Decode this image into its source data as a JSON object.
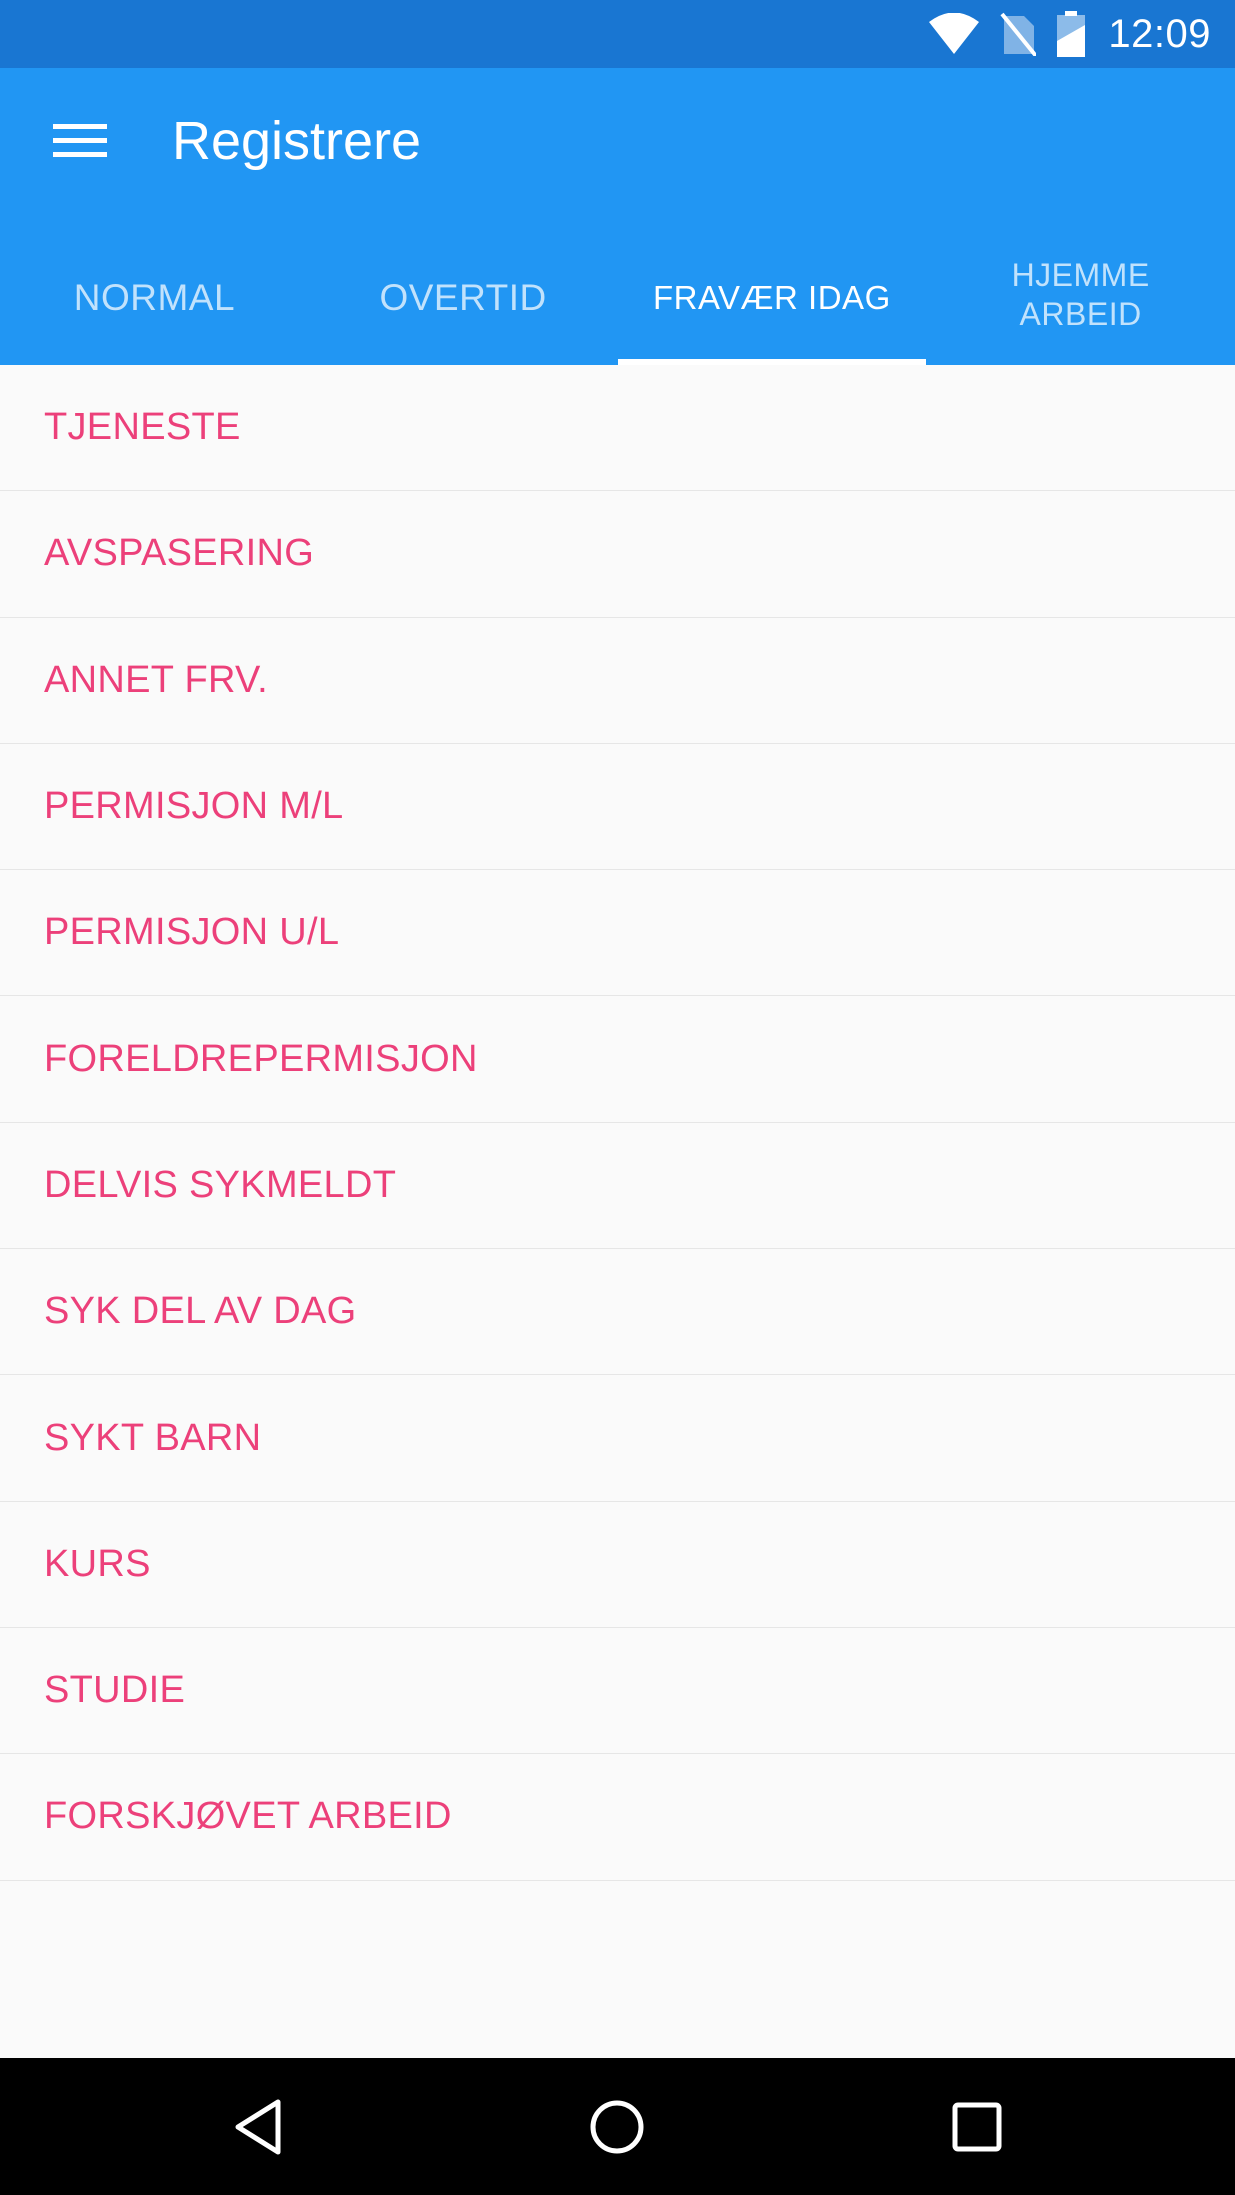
{
  "status_bar": {
    "time": "12:09",
    "icons": [
      "wifi-icon",
      "no-sim-icon",
      "battery-charging-icon"
    ]
  },
  "toolbar": {
    "menu_icon": "hamburger-menu-icon",
    "title": "Registrere"
  },
  "tabs": [
    {
      "label": "NORMAL",
      "active": false
    },
    {
      "label": "OVERTID",
      "active": false
    },
    {
      "label": "FRAVÆR IDAG",
      "active": true
    },
    {
      "label_line1": "HJEMME",
      "label_line2": "ARBEID",
      "active": false
    }
  ],
  "list": {
    "items": [
      "TJENESTE",
      "AVSPASERING",
      "ANNET FRV.",
      "PERMISJON M/L",
      "PERMISJON U/L",
      "FORELDREPERMISJON",
      "DELVIS SYKMELDT",
      "SYK DEL AV DAG",
      "SYKT BARN",
      "KURS",
      "STUDIE",
      "FORSKJØVET ARBEID"
    ]
  },
  "nav_bar": {
    "icons": [
      "back-icon",
      "home-icon",
      "recents-icon"
    ]
  },
  "colors": {
    "status_bar": "#1976d2",
    "app_bar": "#2196f3",
    "list_text": "#ec407a",
    "background": "#fafafa"
  }
}
